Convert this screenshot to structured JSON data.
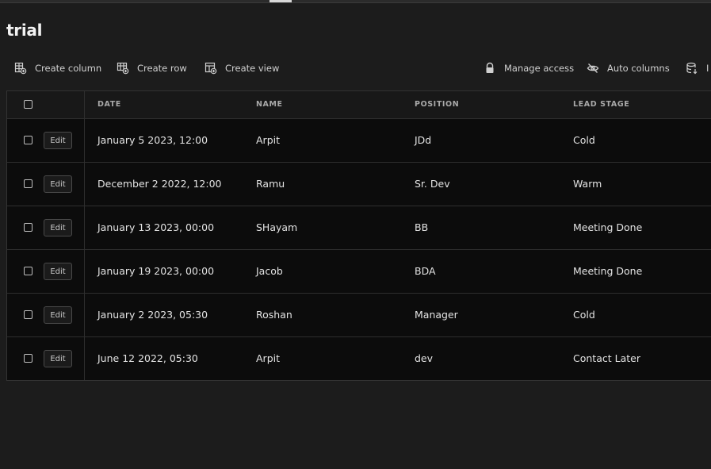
{
  "page": {
    "title": "trial"
  },
  "toolbar": {
    "create_column": "Create column",
    "create_row": "Create row",
    "create_view": "Create view",
    "manage_access": "Manage access",
    "auto_columns": "Auto columns",
    "truncated_label": "I"
  },
  "table": {
    "columns": [
      "DATE",
      "NAME",
      "POSITION",
      "LEAD STAGE"
    ],
    "edit_label": "Edit",
    "rows": [
      {
        "date": "January 5 2023, 12:00",
        "name": "Arpit",
        "position": "JDd",
        "lead_stage": "Cold"
      },
      {
        "date": "December 2 2022, 12:00",
        "name": "Ramu",
        "position": "Sr. Dev",
        "lead_stage": "Warm"
      },
      {
        "date": "January 13 2023, 00:00",
        "name": "SHayam",
        "position": "BB",
        "lead_stage": "Meeting Done"
      },
      {
        "date": "January 19 2023, 00:00",
        "name": "Jacob",
        "position": "BDA",
        "lead_stage": "Meeting Done"
      },
      {
        "date": "January 2 2023, 05:30",
        "name": "Roshan",
        "position": "Manager",
        "lead_stage": "Cold"
      },
      {
        "date": "June 12 2022, 05:30",
        "name": "Arpit",
        "position": "dev",
        "lead_stage": "Contact Later"
      }
    ]
  },
  "colors": {
    "background": "#1c1c1c",
    "grid_background": "#0c0c0c",
    "text": "#e3e3e3",
    "header_text": "#a9a9a9"
  },
  "icons": [
    "create-column-icon",
    "create-row-icon",
    "create-view-icon",
    "lock-icon",
    "eye-off-icon",
    "import-icon"
  ]
}
